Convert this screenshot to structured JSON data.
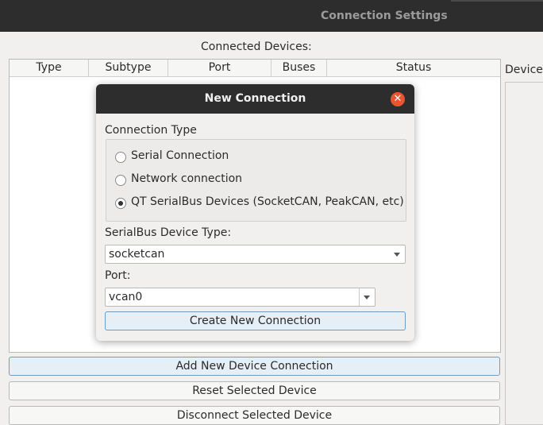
{
  "window": {
    "title": "Connection Settings"
  },
  "main": {
    "connected_label": "Connected Devices:",
    "device_label": "Device",
    "columns": [
      "Type",
      "Subtype",
      "Port",
      "Buses",
      "Status"
    ],
    "buttons": {
      "add": "Add New Device Connection",
      "reset": "Reset Selected Device",
      "disconnect": "Disconnect Selected Device"
    }
  },
  "dialog": {
    "title": "New Connection",
    "close_icon": "close-icon",
    "connection_type_label": "Connection Type",
    "options": [
      {
        "label": "Serial Connection",
        "checked": false
      },
      {
        "label": "Network connection",
        "checked": false
      },
      {
        "label": "QT SerialBus Devices (SocketCAN, PeakCAN, etc)",
        "checked": true
      }
    ],
    "device_type_label": "SerialBus Device Type:",
    "device_type_value": "socketcan",
    "port_label": "Port:",
    "port_value": "vcan0",
    "create_button": "Create New Connection"
  },
  "colors": {
    "titlebar": "#2d2d2d",
    "close": "#e9552f",
    "accent_border": "#6f9cc6"
  }
}
